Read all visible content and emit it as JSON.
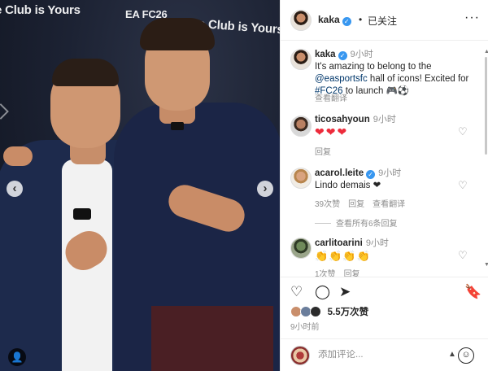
{
  "photo": {
    "backdrop_texts": [
      "e Club is Yours",
      "EA FC26",
      "The Club is Yours"
    ],
    "prev_glyph": "‹",
    "next_glyph": "›",
    "tag_glyph": "👤"
  },
  "header": {
    "username": "kaka",
    "separator": "•",
    "follow_state": "已关注",
    "more_glyph": "···"
  },
  "caption": {
    "username": "kaka",
    "time": "9小时",
    "text_before": "It's amazing to belong to the ",
    "mention": "@easportsfc",
    "text_middle": " hall of icons! Excited for ",
    "hashtag": "#FC26",
    "text_after": " to launch 🎮⚽",
    "translate": "查看翻译"
  },
  "comments": [
    {
      "username": "ticosahyoun",
      "time": "9小时",
      "text": "❤❤❤",
      "meta": [
        "回复"
      ]
    },
    {
      "username": "acarol.leite",
      "time": "9小时",
      "text": "Lindo demais ❤",
      "meta": [
        "39次赞",
        "回复",
        "查看翻译"
      ],
      "view_replies": "查看所有6条回复"
    },
    {
      "username": "carlitoarini",
      "time": "9小时",
      "text": "👏👏👏👏",
      "meta": [
        "1次赞",
        "回复"
      ]
    }
  ],
  "actions": {
    "like_glyph": "♡",
    "comment_glyph": "◯",
    "share_glyph": "➤",
    "save_glyph": "🔖",
    "likes_count": "5.5万次赞",
    "post_time": "9小时前"
  },
  "add_comment": {
    "placeholder": "添加评论...",
    "emoji_glyph": "☺"
  },
  "colors": {
    "link": "#00376b",
    "muted": "#8e8e8e",
    "verified": "#3897f0",
    "heart": "#ed2b3b"
  }
}
